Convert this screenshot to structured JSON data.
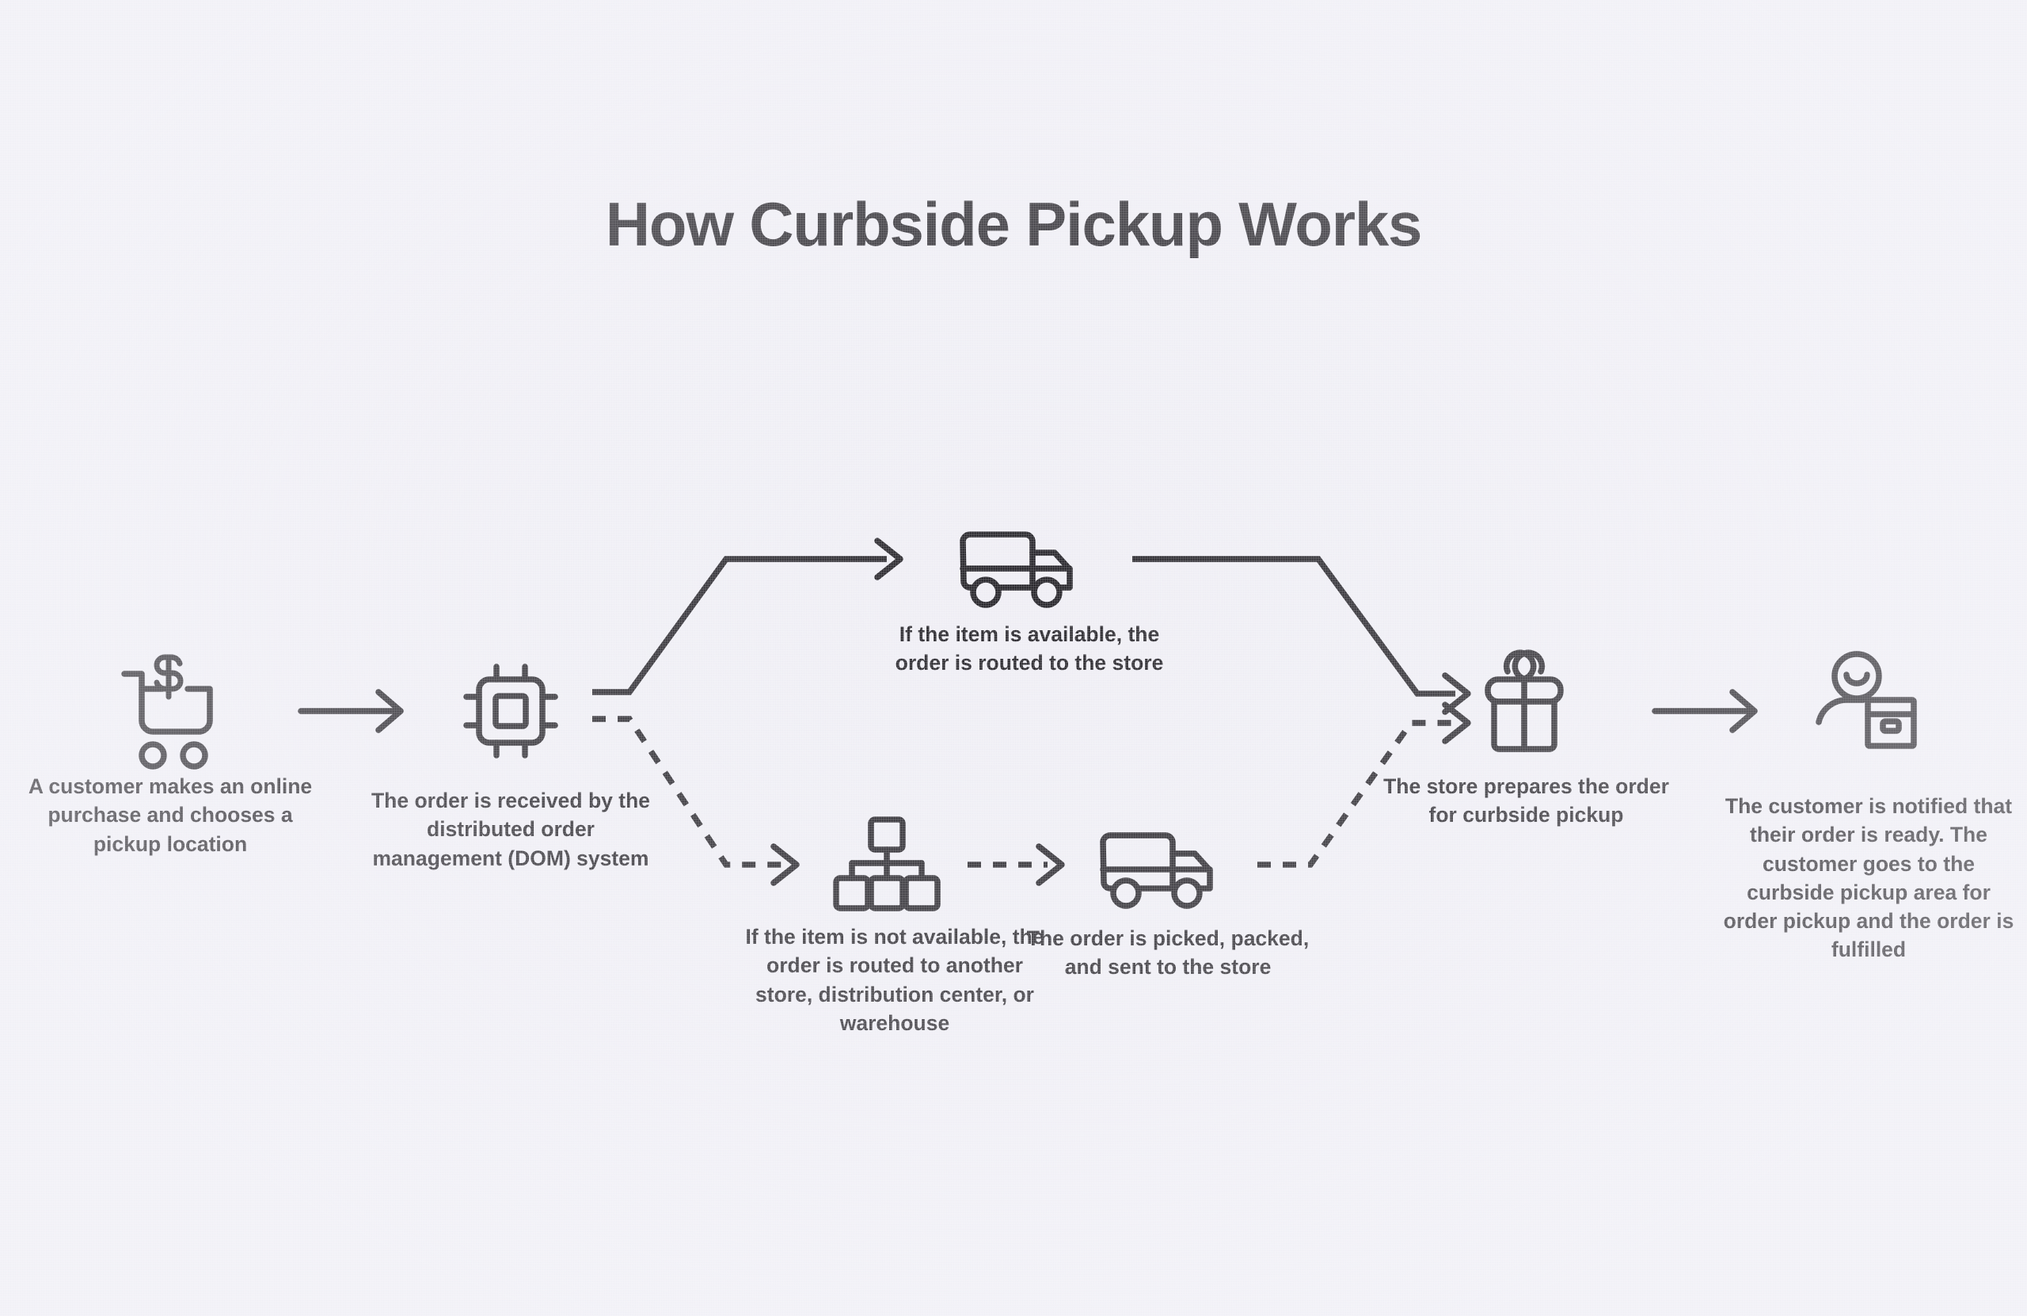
{
  "page": {
    "title": "How Curbside Pickup Works",
    "background_color": "#eeedf4",
    "ink_color": "#18161c"
  },
  "steps": [
    {
      "id": "step-purchase",
      "icon": "shopping-cart-dollar-icon",
      "caption": "A customer makes an online purchase and chooses a pickup location"
    },
    {
      "id": "step-dom-system",
      "icon": "microchip-icon",
      "caption": "The order is received by the distributed order management (DOM) system"
    },
    {
      "id": "step-item-available",
      "icon": "delivery-truck-icon",
      "caption": "If the item is available, the order is routed to the store"
    },
    {
      "id": "step-item-unavailable",
      "icon": "hierarchy-network-icon",
      "caption": "If the item is not available, the order is routed to another store, distribution center, or warehouse"
    },
    {
      "id": "step-picked-packed",
      "icon": "delivery-truck-icon",
      "caption": "The order is picked, packed, and sent to the store"
    },
    {
      "id": "step-store-prepares",
      "icon": "gift-box-icon",
      "caption": "The store prepares the order for curbside pickup"
    },
    {
      "id": "step-customer-notified",
      "icon": "person-with-package-icon",
      "caption": "The customer is notified that their order is ready. The customer goes to the curbside pickup area for order pickup and the order is fulfilled"
    }
  ],
  "connectors": [
    {
      "id": "arrow-purchase-to-dom",
      "style": "solid",
      "from": "step-purchase",
      "to": "step-dom-system"
    },
    {
      "id": "arrow-dom-to-available",
      "style": "solid",
      "from": "step-dom-system",
      "to": "step-item-available"
    },
    {
      "id": "arrow-dom-to-unavailable",
      "style": "dashed",
      "from": "step-dom-system",
      "to": "step-item-unavailable"
    },
    {
      "id": "arrow-unavailable-to-picked",
      "style": "dashed",
      "from": "step-item-unavailable",
      "to": "step-picked-packed"
    },
    {
      "id": "arrow-available-to-store",
      "style": "solid",
      "from": "step-item-available",
      "to": "step-store-prepares"
    },
    {
      "id": "arrow-picked-to-store",
      "style": "dashed",
      "from": "step-picked-packed",
      "to": "step-store-prepares"
    },
    {
      "id": "arrow-store-to-customer",
      "style": "solid",
      "from": "step-store-prepares",
      "to": "step-customer-notified"
    }
  ]
}
